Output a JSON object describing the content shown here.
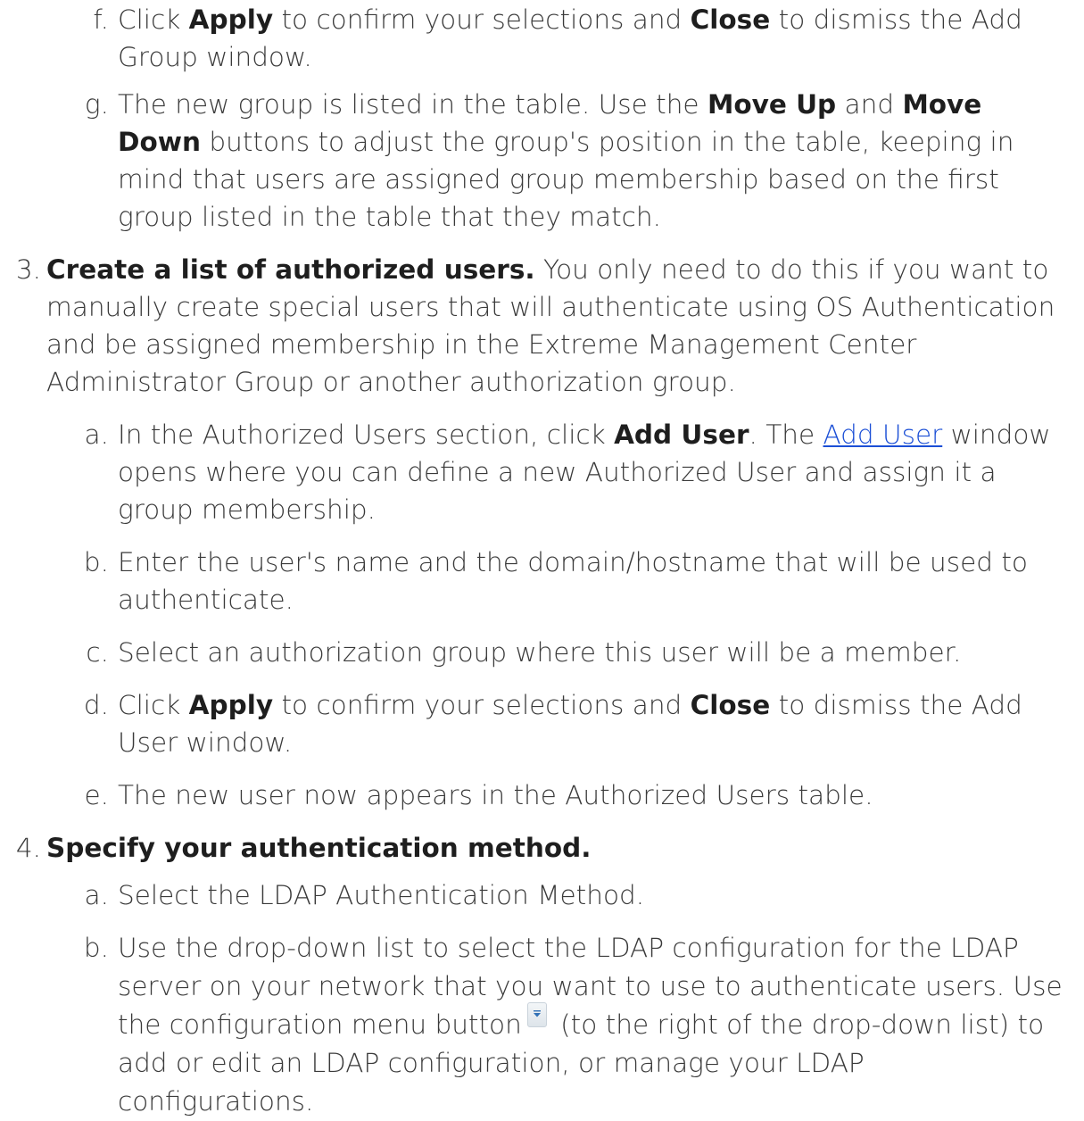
{
  "step2": {
    "f": {
      "marker": "f.",
      "t1": "Click ",
      "apply": "Apply",
      "t2": " to confirm your selections and ",
      "close": "Close",
      "t3": " to dismiss the Add Group window."
    },
    "g": {
      "marker": "g.",
      "t1": "The new group is listed in the table. Use the ",
      "move_up": "Move Up",
      "t2": " and ",
      "move_down": "Move Down",
      "t3": " buttons to adjust the group's position in the table, keeping in mind that users are assigned group membership based on the first group listed in the table that they match."
    }
  },
  "step3": {
    "marker": "3.",
    "heading": "Create a list of authorized users.",
    "text": " You only need to do this if you want to manually create special users that will authenticate using OS Authentication and be assigned membership in the Extreme Management Center Administrator Group or another authorization group.",
    "a": {
      "marker": "a.",
      "t1": "In the Authorized Users section, click ",
      "add_user": "Add User",
      "t2": ". The ",
      "link": "Add User",
      "t3": " window opens where you can define a new Authorized User and assign it a group membership."
    },
    "b": {
      "marker": "b.",
      "text": "Enter the user's name and the domain/hostname that will be used to authenticate."
    },
    "c": {
      "marker": "c.",
      "text": "Select an authorization group where this user will be a member."
    },
    "d": {
      "marker": "d.",
      "t1": "Click ",
      "apply": "Apply",
      "t2": " to confirm your selections and ",
      "close": "Close",
      "t3": " to dismiss the Add User window."
    },
    "e": {
      "marker": "e.",
      "text": "The new user now appears in the Authorized Users table."
    }
  },
  "step4": {
    "marker": "4.",
    "heading": "Specify your authentication method.",
    "a": {
      "marker": "a.",
      "text": "Select the LDAP Authentication Method."
    },
    "b": {
      "marker": "b.",
      "t1": "Use the drop-down list to select the LDAP configuration for the LDAP server on your network that you want to use to authenticate users. Use the configuration menu button",
      "t2": " (to the right of the drop-down list) to add or edit an LDAP configuration, or manage your LDAP configurations."
    }
  },
  "icons": {
    "config_menu": "dropdown-arrow-icon"
  }
}
